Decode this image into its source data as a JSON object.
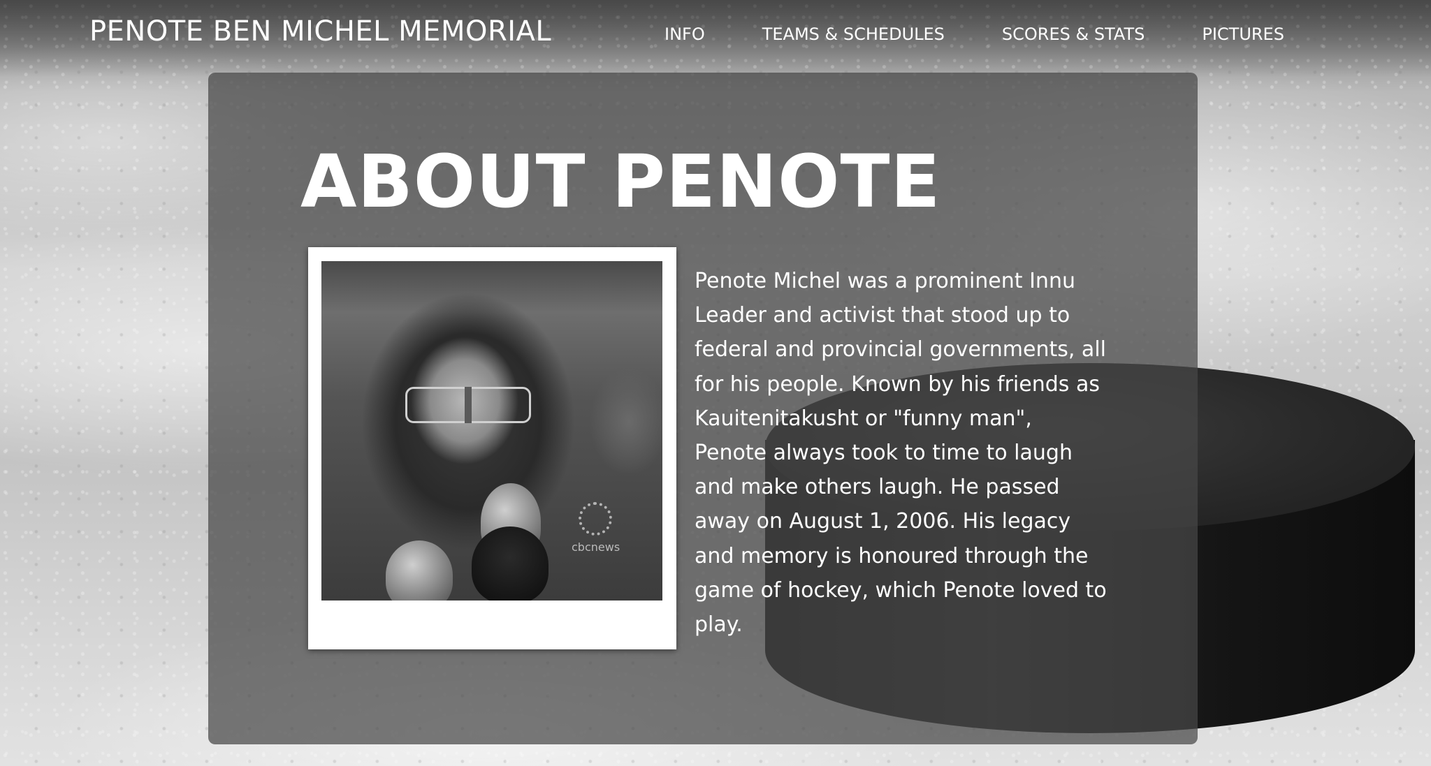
{
  "header": {
    "site_title": "PENOTE BEN MICHEL MEMORIAL",
    "nav": [
      {
        "label": "INFO"
      },
      {
        "label": "TEAMS & SCHEDULES"
      },
      {
        "label": "SCORES & STATS"
      },
      {
        "label": "PICTURES"
      }
    ]
  },
  "main": {
    "heading": "ABOUT PENOTE",
    "photo_watermark": "cbcnews",
    "bio": "Penote Michel was a prominent Innu Leader and activist that stood up to federal and provincial governments, all for his people. Known by his friends as Kauitenitakusht or \"funny man\", Penote always took to time to laugh and make others laugh. He passed away on August 1, 2006. His legacy and memory is honoured through the game of hockey, which Penote loved to play."
  }
}
